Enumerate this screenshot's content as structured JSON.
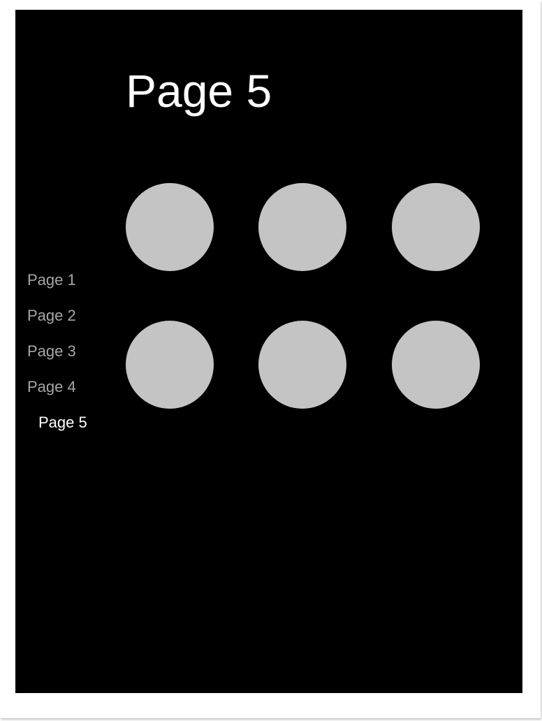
{
  "page": {
    "title": "Page 5"
  },
  "nav": {
    "items": [
      {
        "label": "Page 1",
        "active": false
      },
      {
        "label": "Page 2",
        "active": false
      },
      {
        "label": "Page 3",
        "active": false
      },
      {
        "label": "Page 4",
        "active": false
      },
      {
        "label": "Page 5",
        "active": true
      }
    ]
  },
  "grid": {
    "rows": 2,
    "columns": 3,
    "tile_count": 6
  },
  "colors": {
    "background": "#000000",
    "frame": "#ffffff",
    "tile": "#c4c4c4",
    "nav_inactive": "#a6a6a6",
    "nav_active": "#ffffff",
    "title": "#ffffff"
  }
}
